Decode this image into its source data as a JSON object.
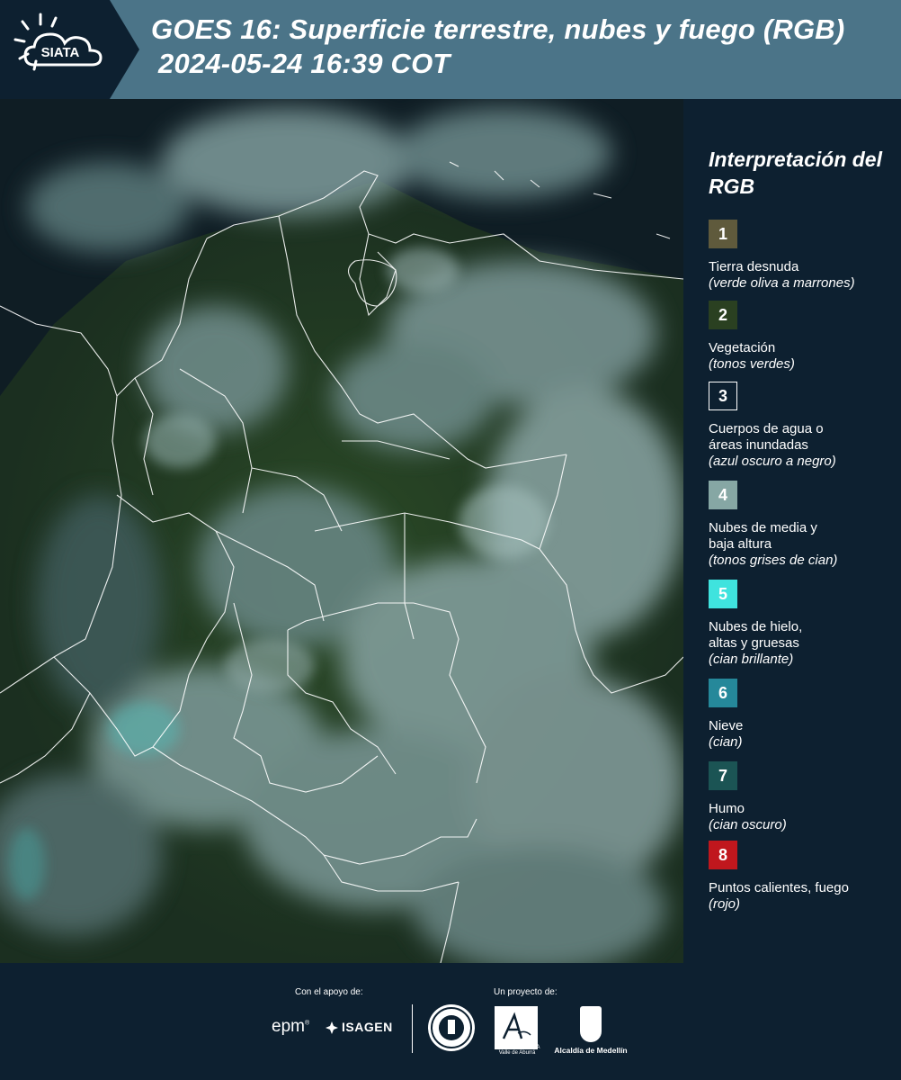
{
  "header": {
    "logo_text": "SIATA",
    "title_line1": "GOES 16: Superficie terrestre, nubes y fuego (RGB)",
    "title_line2": "2024-05-24 16:39 COT",
    "colors": {
      "background": "#4b7488",
      "logo_bg": "#0d2030"
    }
  },
  "map": {
    "description_icon": "satellite-rgb-map",
    "colors": {
      "background": "#1a2e2e",
      "border": "#ffffff"
    }
  },
  "legend": {
    "title": "Interpretación del RGB",
    "items": [
      {
        "number": "1",
        "label": "Tierra desnuda",
        "sub": "(verde oliva a marrones)",
        "color": "#5f5a3c"
      },
      {
        "number": "2",
        "label": "Vegetación",
        "sub": "(tonos verdes)",
        "color": "#2a4021"
      },
      {
        "number": "3",
        "label": "Cuerpos de agua o áreas inundadas",
        "sub": "(azul oscuro a negro)",
        "color": "#0d2030"
      },
      {
        "number": "4",
        "label": "Nubes de media y baja altura",
        "sub": "(tonos grises de cian)",
        "color": "#86a7a4"
      },
      {
        "number": "5",
        "label": "Nubes de hielo, altas y gruesas",
        "sub": "(cian brillante)",
        "color": "#3fe3de"
      },
      {
        "number": "6",
        "label": "Nieve",
        "sub": "(cian)",
        "color": "#25889a"
      },
      {
        "number": "7",
        "label": "Humo",
        "sub": "(cian oscuro)",
        "color": "#1b5454"
      },
      {
        "number": "8",
        "label": "Puntos calientes, fuego",
        "sub": "(rojo)",
        "color": "#c0171d"
      }
    ]
  },
  "footer": {
    "support_label": "Con el apoyo de:",
    "project_label": "Un proyecto de:",
    "epm": "epm",
    "isagen": "ISAGEN",
    "area_text": "METROPOLITANA Valle de Aburrá",
    "medellin": "Alcaldía de Medellín"
  }
}
